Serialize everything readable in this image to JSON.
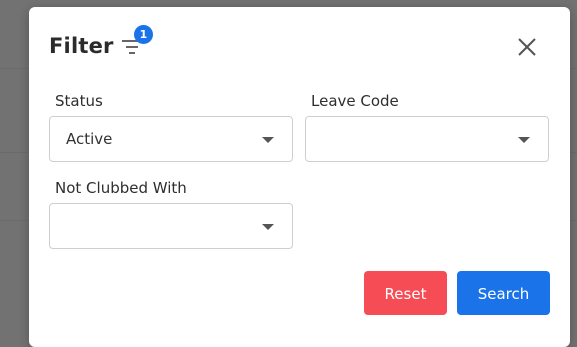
{
  "dialog": {
    "title": "Filter",
    "filter_count": "1",
    "icons": {
      "filter": "filter-lines-icon",
      "close": "close-icon",
      "dropdown": "caret-down-icon"
    }
  },
  "fields": {
    "status": {
      "label": "Status",
      "value": "Active"
    },
    "leave_code": {
      "label": "Leave Code",
      "value": ""
    },
    "not_clubbed_with": {
      "label": "Not Clubbed With",
      "value": ""
    }
  },
  "actions": {
    "reset_label": "Reset",
    "search_label": "Search"
  },
  "colors": {
    "primary": "#1a73e8",
    "danger": "#f64c55",
    "badge": "#1a73e8"
  }
}
